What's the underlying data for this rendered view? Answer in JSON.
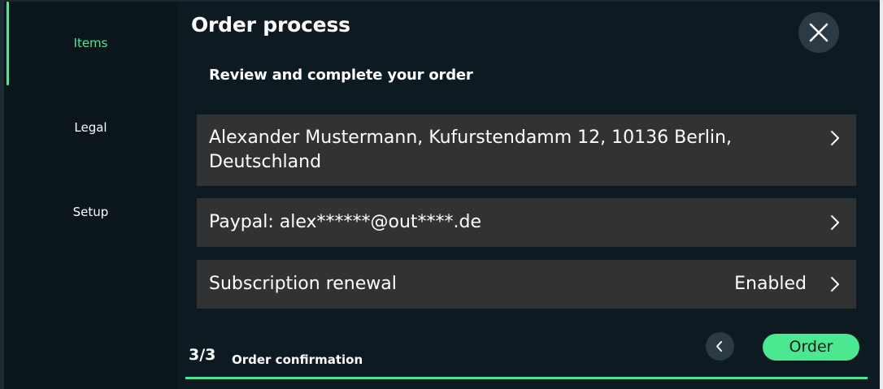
{
  "sidebar": {
    "items": [
      {
        "label": "Items",
        "active": true
      },
      {
        "label": "Legal",
        "active": false
      },
      {
        "label": "Setup",
        "active": false
      }
    ]
  },
  "header": {
    "title": "Order process",
    "close_icon": "close-icon"
  },
  "main": {
    "subtitle": "Review and complete your order",
    "rows": [
      {
        "text": "Alexander Mustermann, Kufurstendamm 12, 10136 Berlin, Deutschland",
        "value": "",
        "icon": "chevron-right-icon"
      },
      {
        "text": "Paypal: alex******@out****.de",
        "value": "",
        "icon": "chevron-right-icon"
      },
      {
        "text": "Subscription renewal",
        "value": "Enabled",
        "icon": "chevron-right-icon"
      }
    ]
  },
  "footer": {
    "step": "3/3",
    "step_label": "Order confirmation",
    "back_icon": "chevron-left-icon",
    "order_label": "Order",
    "progress": 1.0
  },
  "colors": {
    "accent": "#4be891",
    "background": "#0d1a22",
    "sidebar": "#0b151c",
    "row": "#313234",
    "button_dark": "#2b3a44"
  }
}
